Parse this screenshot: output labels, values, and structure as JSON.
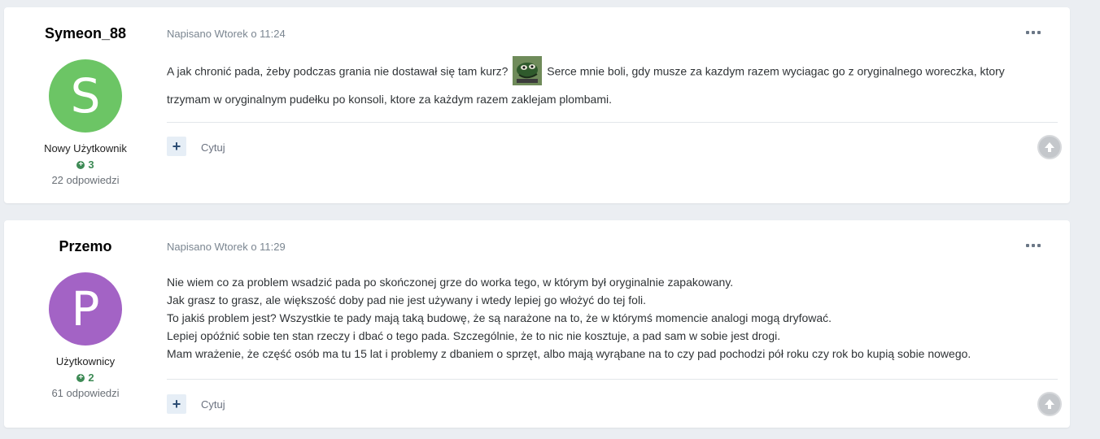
{
  "posts": [
    {
      "author": "Symeon_88",
      "avatar_letter": "S",
      "avatar_color": "#6cc565",
      "rank": "Nowy Użytkownik",
      "reputation": "3",
      "replies": "22 odpowiedzi",
      "meta": "Napisano Wtorek o 11:24",
      "lines": [
        "A jak chronić pada, żeby podczas grania nie dostawał się tam kurz?",
        "Serce mnie boli, gdy musze za kazdym razem wyciagac go z oryginalnego woreczka, ktory",
        "trzymam w oryginalnym pudełku po konsoli, ktore za każdym razem zaklejam plombami."
      ],
      "emoji": "thinking-frog-emoji",
      "quote_label": "Cytuj"
    },
    {
      "author": "Przemo",
      "avatar_letter": "P",
      "avatar_color": "#a363c5",
      "rank": "Użytkownicy",
      "reputation": "2",
      "replies": "61 odpowiedzi",
      "meta": "Napisano Wtorek o 11:29",
      "lines": [
        "Nie wiem co za problem wsadzić pada po skończonej grze do worka tego, w którym był oryginalnie zapakowany.",
        "Jak grasz to grasz, ale większość doby pad nie jest używany i wtedy lepiej go włożyć do tej foli.",
        "To jakiś problem jest? Wszystkie te pady mają taką budowę, że są narażone na to, że w którymś momencie analogi mogą dryfować.",
        "Lepiej opóźnić sobie ten stan rzeczy i dbać o tego pada. Szczególnie, że to nic nie kosztuje, a pad sam w sobie jest drogi.",
        "Mam wrażenie, że część osób ma tu 15 lat i problemy z dbaniem o sprzęt, albo mają wyrąbane na to czy pad pochodzi pół roku czy rok bo kupią sobie nowego."
      ],
      "quote_label": "Cytuj"
    }
  ]
}
